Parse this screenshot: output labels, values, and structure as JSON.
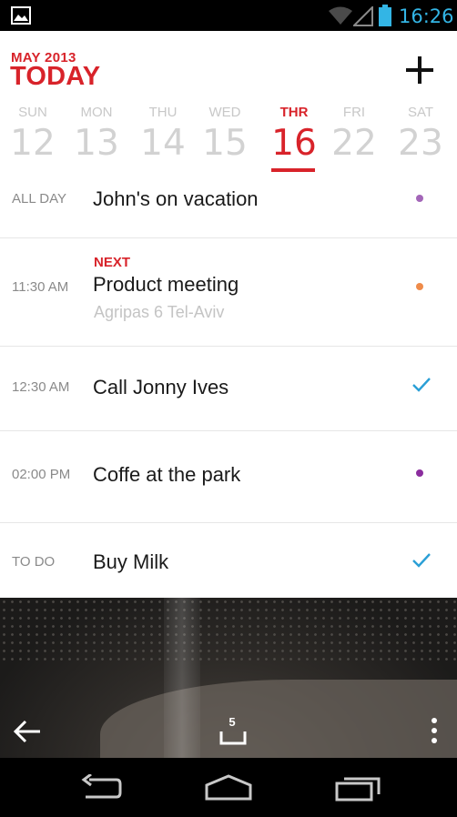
{
  "status_bar": {
    "time": "16:26"
  },
  "header": {
    "month": "MAY 2013",
    "title": "TODAY"
  },
  "week": [
    {
      "dow": "SUN",
      "num": "12"
    },
    {
      "dow": "MON",
      "num": "13"
    },
    {
      "dow": "THU",
      "num": "14"
    },
    {
      "dow": "WED",
      "num": "15"
    },
    {
      "dow": "THR",
      "num": "16"
    },
    {
      "dow": "FRI",
      "num": "22"
    },
    {
      "dow": "SAT",
      "num": "23"
    }
  ],
  "events": [
    {
      "time": "ALL DAY",
      "title": "John's on vacation",
      "marker": "dot",
      "color": "#a366b8"
    },
    {
      "time": "11:30 AM",
      "tag": "NEXT",
      "title": "Product meeting",
      "location": "Agripas 6 Tel-Aviv",
      "marker": "dot",
      "color": "#ef8b4a"
    },
    {
      "time": "12:30 AM",
      "title": "Call Jonny Ives",
      "marker": "check",
      "color": "#2a9fd6"
    },
    {
      "time": "02:00 PM",
      "title": "Coffe at the park",
      "marker": "dot",
      "color": "#8b2d9e"
    },
    {
      "time": "TO DO",
      "title": "Buy Milk",
      "marker": "check",
      "color": "#2a9fd6"
    }
  ],
  "toolbar": {
    "inbox_count": "5"
  },
  "colors": {
    "accent": "#d8232a",
    "status_time": "#33b5e5"
  }
}
